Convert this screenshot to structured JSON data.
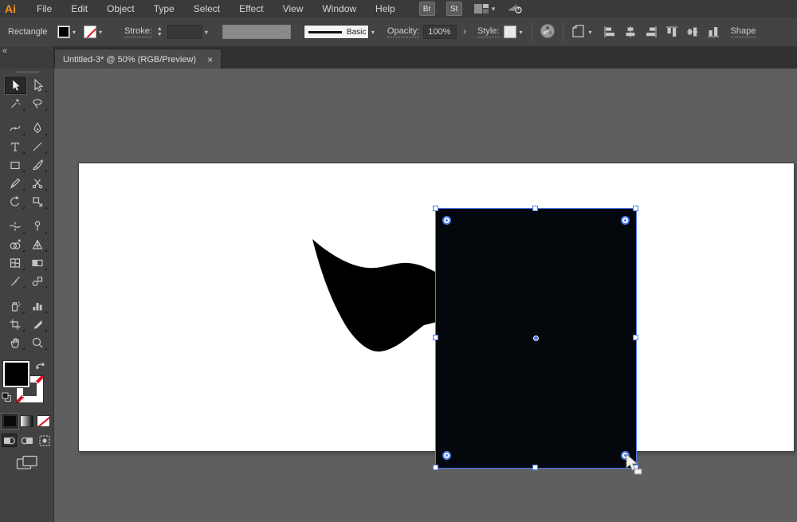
{
  "colors": {
    "selection_blue": "#4b7cf3",
    "logo_orange": "#f7941d",
    "stroke_none_red": "#dd1122",
    "artboard_white": "#ffffff",
    "shape_fill": "#000000"
  },
  "menu_bar": {
    "logo": "Ai",
    "items": [
      "File",
      "Edit",
      "Object",
      "Type",
      "Select",
      "Effect",
      "View",
      "Window",
      "Help"
    ],
    "bridge_label": "Br",
    "stock_label": "St"
  },
  "control_bar": {
    "context_label": "Rectangle",
    "fill_swatch": "black",
    "stroke_swatch": "none",
    "stroke_label": "Stroke:",
    "brush_name": "Basic",
    "opacity_label": "Opacity:",
    "opacity_value": "100%",
    "opacity_more": "›",
    "style_label": "Style:",
    "shape_label": "Shape",
    "align_icons": [
      "horizontal-align-left",
      "horizontal-align-center",
      "horizontal-align-right",
      "vertical-align-top",
      "vertical-align-center",
      "vertical-align-bottom"
    ]
  },
  "document_tab": {
    "title": "Untitled-3* @ 50% (RGB/Preview)",
    "close": "×"
  },
  "toolbar": {
    "collapse_glyph": "«",
    "tools": [
      {
        "name": "selection-tool",
        "active": true
      },
      {
        "name": "direct-selection-tool",
        "active": false
      },
      {
        "name": "magic-wand-tool",
        "active": false
      },
      {
        "name": "lasso-tool",
        "active": false
      },
      {
        "name": "curvature-tool",
        "active": false
      },
      {
        "name": "pen-tool",
        "active": false
      },
      {
        "name": "type-tool",
        "active": false
      },
      {
        "name": "line-segment-tool",
        "active": false
      },
      {
        "name": "rectangle-tool",
        "active": false
      },
      {
        "name": "paintbrush-tool",
        "active": false
      },
      {
        "name": "pencil-tool",
        "active": false
      },
      {
        "name": "scissors-tool",
        "active": false
      },
      {
        "name": "rotate-tool",
        "active": false
      },
      {
        "name": "scale-tool",
        "active": false
      },
      {
        "name": "width-tool",
        "active": false
      },
      {
        "name": "puppet-warp-tool",
        "active": false
      },
      {
        "name": "shape-builder-tool",
        "active": false
      },
      {
        "name": "perspective-grid-tool",
        "active": false
      },
      {
        "name": "mesh-tool",
        "active": false
      },
      {
        "name": "gradient-tool",
        "active": false
      },
      {
        "name": "eyedropper-tool",
        "active": false
      },
      {
        "name": "blend-tool",
        "active": false
      },
      {
        "name": "symbol-sprayer-tool",
        "active": false
      },
      {
        "name": "column-graph-tool",
        "active": false
      },
      {
        "name": "artboard-tool",
        "active": false
      },
      {
        "name": "slice-tool",
        "active": false
      },
      {
        "name": "hand-tool",
        "active": false
      },
      {
        "name": "zoom-tool",
        "active": false
      }
    ],
    "swatch_buttons": [
      "color",
      "gradient",
      "none"
    ],
    "drawing_modes": [
      "draw-normal",
      "draw-behind",
      "draw-inside"
    ]
  }
}
